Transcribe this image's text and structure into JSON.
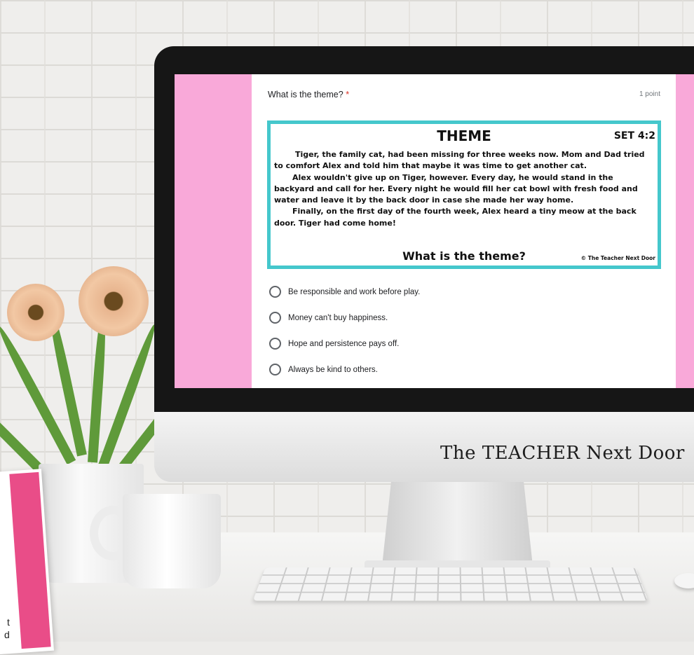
{
  "form": {
    "question": "What is the theme?",
    "required_mark": "*",
    "points": "1 point"
  },
  "passage": {
    "heading": "THEME",
    "set": "SET 4:2",
    "paragraphs": [
      "Tiger, the family cat, had been missing for three weeks now. Mom and Dad tried to comfort Alex and told him that maybe it was time to get another cat.",
      "Alex wouldn't give up on Tiger, however. Every day, he would stand in the backyard and call for her. Every night he would fill her cat bowl with fresh food and water and leave it by the back door in case she made her way home.",
      "Finally, on the first day of the fourth week, Alex heard a tiny meow at the back door. Tiger had come home!"
    ],
    "question": "What is the theme?",
    "copyright": "© The Teacher Next Door"
  },
  "options": [
    "Be responsible and work before play.",
    "Money can't buy happiness.",
    "Hope and persistence pays off.",
    "Always be kind to others."
  ],
  "monitor_brand": "The TEACHER Next Door",
  "notebook_letters": [
    "t",
    "d"
  ],
  "colors": {
    "screen_background": "#f9a9d9",
    "passage_border": "#45c7cc",
    "required": "#d93025"
  }
}
